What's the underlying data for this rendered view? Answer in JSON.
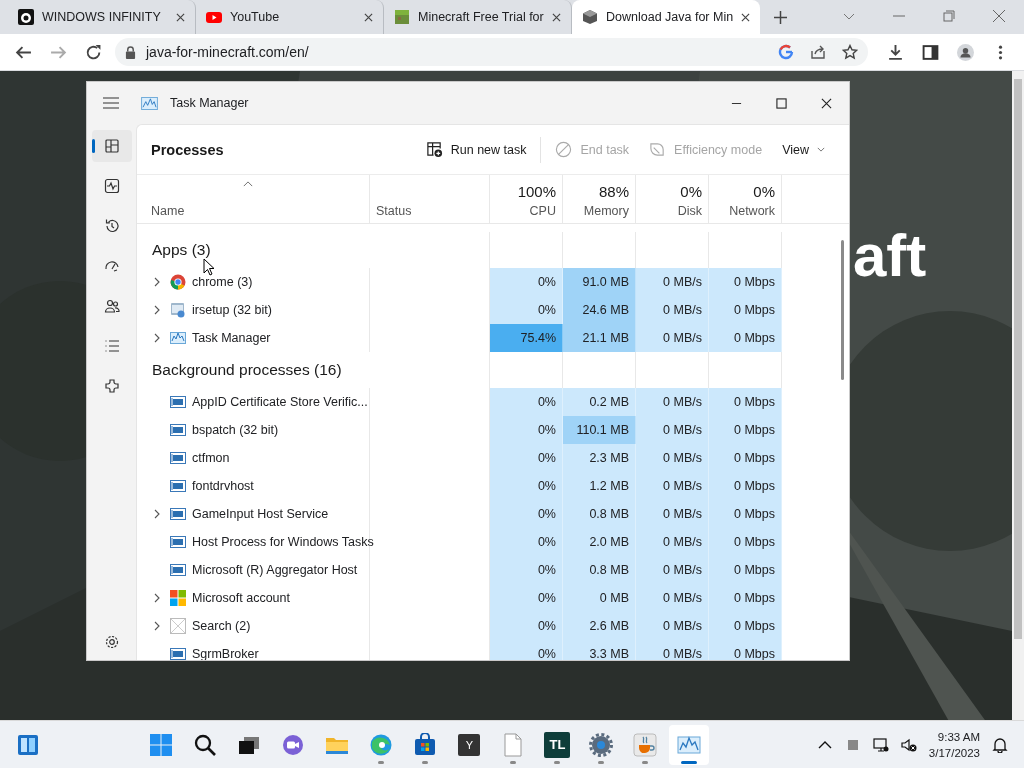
{
  "browser": {
    "tabs": [
      {
        "title": "WINDOWS INFINITY",
        "kind": "infinity",
        "selected": false
      },
      {
        "title": "YouTube",
        "kind": "youtube",
        "selected": false
      },
      {
        "title": "Minecraft Free Trial for",
        "kind": "minecraft",
        "selected": false
      },
      {
        "title": "Download Java for Min",
        "kind": "java",
        "selected": true
      }
    ],
    "address": "java-for-minecraft.com/en/"
  },
  "page": {
    "heading_visible": "aft"
  },
  "task_manager": {
    "title": "Task Manager",
    "nav": [
      {
        "kind": "processes",
        "selected": true
      },
      {
        "kind": "performance",
        "selected": false
      },
      {
        "kind": "history",
        "selected": false
      },
      {
        "kind": "startup",
        "selected": false
      },
      {
        "kind": "users",
        "selected": false
      },
      {
        "kind": "details",
        "selected": false
      },
      {
        "kind": "services",
        "selected": false
      }
    ],
    "section_title": "Processes",
    "toolbar": [
      {
        "kind": "run",
        "label": "Run new task",
        "disabled": false
      },
      {
        "kind": "end",
        "label": "End task",
        "disabled": true
      },
      {
        "kind": "efficiency",
        "label": "Efficiency mode",
        "disabled": true
      },
      {
        "kind": "view",
        "label": "View",
        "disabled": false
      }
    ],
    "columns": [
      {
        "label": "Name"
      },
      {
        "label": "Status"
      },
      {
        "percent": "100%",
        "label": "CPU"
      },
      {
        "percent": "88%",
        "label": "Memory"
      },
      {
        "percent": "0%",
        "label": "Disk"
      },
      {
        "percent": "0%",
        "label": "Network"
      }
    ],
    "groups": [
      {
        "title": "Apps (3)",
        "rows": [
          {
            "name": "chrome (3)",
            "kind": "chrome",
            "expandable": true,
            "cells": [
              {
                "text": "0%",
                "color": "#cce8fc"
              },
              {
                "text": "91.0 MB",
                "color": "#9fd3f7"
              },
              {
                "text": "0 MB/s",
                "color": "#cce8fc"
              },
              {
                "text": "0 Mbps",
                "color": "#cce8fc"
              }
            ]
          },
          {
            "name": "irsetup (32 bit)",
            "kind": "installer",
            "expandable": true,
            "cells": [
              {
                "text": "0%",
                "color": "#cce8fc"
              },
              {
                "text": "24.6 MB",
                "color": "#9fd3f7"
              },
              {
                "text": "0 MB/s",
                "color": "#cce8fc"
              },
              {
                "text": "0 Mbps",
                "color": "#cce8fc"
              }
            ]
          },
          {
            "name": "Task Manager",
            "kind": "taskmgr",
            "expandable": true,
            "cells": [
              {
                "text": "75.4%",
                "color": "#4aaef0"
              },
              {
                "text": "21.1 MB",
                "color": "#9fd3f7"
              },
              {
                "text": "0 MB/s",
                "color": "#cce8fc"
              },
              {
                "text": "0 Mbps",
                "color": "#cce8fc"
              }
            ]
          }
        ]
      },
      {
        "title": "Background processes (16)",
        "rows": [
          {
            "name": "AppID Certificate Store Verific...",
            "kind": "service",
            "expandable": false,
            "cells": [
              {
                "text": "0%",
                "color": "#cce8fc"
              },
              {
                "text": "0.2 MB",
                "color": "#cce8fc"
              },
              {
                "text": "0 MB/s",
                "color": "#cce8fc"
              },
              {
                "text": "0 Mbps",
                "color": "#cce8fc"
              }
            ]
          },
          {
            "name": "bspatch (32 bit)",
            "kind": "service",
            "expandable": false,
            "cells": [
              {
                "text": "0%",
                "color": "#cce8fc"
              },
              {
                "text": "110.1 MB",
                "color": "#9fd3f7"
              },
              {
                "text": "0 MB/s",
                "color": "#cce8fc"
              },
              {
                "text": "0 Mbps",
                "color": "#cce8fc"
              }
            ]
          },
          {
            "name": "ctfmon",
            "kind": "service",
            "expandable": false,
            "cells": [
              {
                "text": "0%",
                "color": "#cce8fc"
              },
              {
                "text": "2.3 MB",
                "color": "#cce8fc"
              },
              {
                "text": "0 MB/s",
                "color": "#cce8fc"
              },
              {
                "text": "0 Mbps",
                "color": "#cce8fc"
              }
            ]
          },
          {
            "name": "fontdrvhost",
            "kind": "service",
            "expandable": false,
            "cells": [
              {
                "text": "0%",
                "color": "#cce8fc"
              },
              {
                "text": "1.2 MB",
                "color": "#cce8fc"
              },
              {
                "text": "0 MB/s",
                "color": "#cce8fc"
              },
              {
                "text": "0 Mbps",
                "color": "#cce8fc"
              }
            ]
          },
          {
            "name": "GameInput Host Service",
            "kind": "service",
            "expandable": true,
            "cells": [
              {
                "text": "0%",
                "color": "#cce8fc"
              },
              {
                "text": "0.8 MB",
                "color": "#cce8fc"
              },
              {
                "text": "0 MB/s",
                "color": "#cce8fc"
              },
              {
                "text": "0 Mbps",
                "color": "#cce8fc"
              }
            ]
          },
          {
            "name": "Host Process for Windows Tasks",
            "kind": "service",
            "expandable": false,
            "cells": [
              {
                "text": "0%",
                "color": "#cce8fc"
              },
              {
                "text": "2.0 MB",
                "color": "#cce8fc"
              },
              {
                "text": "0 MB/s",
                "color": "#cce8fc"
              },
              {
                "text": "0 Mbps",
                "color": "#cce8fc"
              }
            ]
          },
          {
            "name": "Microsoft (R) Aggregator Host",
            "kind": "service",
            "expandable": false,
            "cells": [
              {
                "text": "0%",
                "color": "#cce8fc"
              },
              {
                "text": "0.8 MB",
                "color": "#cce8fc"
              },
              {
                "text": "0 MB/s",
                "color": "#cce8fc"
              },
              {
                "text": "0 Mbps",
                "color": "#cce8fc"
              }
            ]
          },
          {
            "name": "Microsoft account",
            "kind": "microsoft",
            "expandable": true,
            "cells": [
              {
                "text": "0%",
                "color": "#cce8fc"
              },
              {
                "text": "0 MB",
                "color": "#cce8fc"
              },
              {
                "text": "0 MB/s",
                "color": "#cce8fc"
              },
              {
                "text": "0 Mbps",
                "color": "#cce8fc"
              }
            ]
          },
          {
            "name": "Search (2)",
            "kind": "blank",
            "expandable": true,
            "cells": [
              {
                "text": "0%",
                "color": "#cce8fc"
              },
              {
                "text": "2.6 MB",
                "color": "#cce8fc"
              },
              {
                "text": "0 MB/s",
                "color": "#cce8fc"
              },
              {
                "text": "0 Mbps",
                "color": "#cce8fc"
              }
            ]
          },
          {
            "name": "SgrmBroker",
            "kind": "service",
            "expandable": false,
            "cells": [
              {
                "text": "0%",
                "color": "#cce8fc"
              },
              {
                "text": "3.3 MB",
                "color": "#cce8fc"
              },
              {
                "text": "0 MB/s",
                "color": "#cce8fc"
              },
              {
                "text": "0 Mbps",
                "color": "#cce8fc"
              }
            ]
          }
        ]
      }
    ]
  },
  "taskbar": {
    "apps": [
      {
        "kind": "start",
        "running": false,
        "selected": false
      },
      {
        "kind": "search",
        "running": false,
        "selected": false
      },
      {
        "kind": "taskview",
        "running": false,
        "selected": false
      },
      {
        "kind": "chat",
        "running": false,
        "selected": false
      },
      {
        "kind": "explorer",
        "running": false,
        "selected": false
      },
      {
        "kind": "edge",
        "running": true,
        "selected": false
      },
      {
        "kind": "store",
        "running": true,
        "selected": false
      },
      {
        "kind": "letter",
        "label": "Y",
        "running": false,
        "selected": false
      },
      {
        "kind": "notepad",
        "running": true,
        "selected": false
      },
      {
        "kind": "letter",
        "label": "TL",
        "running": true,
        "selected": false
      },
      {
        "kind": "settings",
        "running": true,
        "selected": false
      },
      {
        "kind": "java",
        "running": true,
        "selected": false
      },
      {
        "kind": "taskmgr",
        "running": true,
        "selected": true
      }
    ],
    "time": "9:33 AM",
    "date": "3/17/2023"
  }
}
